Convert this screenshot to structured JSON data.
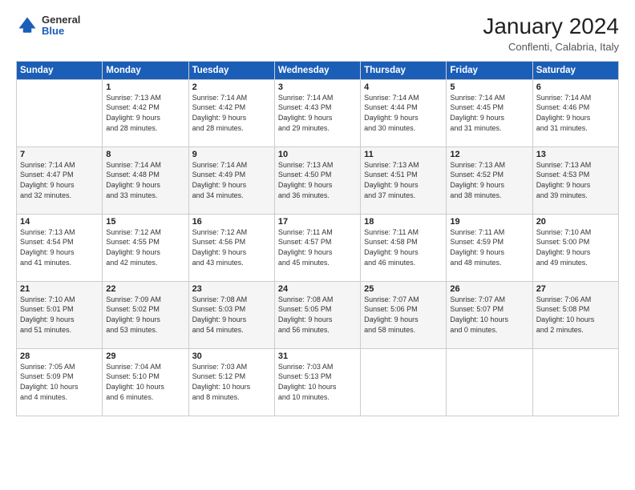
{
  "logo": {
    "general": "General",
    "blue": "Blue"
  },
  "header": {
    "month_year": "January 2024",
    "location": "Conflenti, Calabria, Italy"
  },
  "days_of_week": [
    "Sunday",
    "Monday",
    "Tuesday",
    "Wednesday",
    "Thursday",
    "Friday",
    "Saturday"
  ],
  "weeks": [
    [
      {
        "day": "",
        "info": ""
      },
      {
        "day": "1",
        "info": "Sunrise: 7:13 AM\nSunset: 4:42 PM\nDaylight: 9 hours\nand 28 minutes."
      },
      {
        "day": "2",
        "info": "Sunrise: 7:14 AM\nSunset: 4:42 PM\nDaylight: 9 hours\nand 28 minutes."
      },
      {
        "day": "3",
        "info": "Sunrise: 7:14 AM\nSunset: 4:43 PM\nDaylight: 9 hours\nand 29 minutes."
      },
      {
        "day": "4",
        "info": "Sunrise: 7:14 AM\nSunset: 4:44 PM\nDaylight: 9 hours\nand 30 minutes."
      },
      {
        "day": "5",
        "info": "Sunrise: 7:14 AM\nSunset: 4:45 PM\nDaylight: 9 hours\nand 31 minutes."
      },
      {
        "day": "6",
        "info": "Sunrise: 7:14 AM\nSunset: 4:46 PM\nDaylight: 9 hours\nand 31 minutes."
      }
    ],
    [
      {
        "day": "7",
        "info": "Sunrise: 7:14 AM\nSunset: 4:47 PM\nDaylight: 9 hours\nand 32 minutes."
      },
      {
        "day": "8",
        "info": "Sunrise: 7:14 AM\nSunset: 4:48 PM\nDaylight: 9 hours\nand 33 minutes."
      },
      {
        "day": "9",
        "info": "Sunrise: 7:14 AM\nSunset: 4:49 PM\nDaylight: 9 hours\nand 34 minutes."
      },
      {
        "day": "10",
        "info": "Sunrise: 7:13 AM\nSunset: 4:50 PM\nDaylight: 9 hours\nand 36 minutes."
      },
      {
        "day": "11",
        "info": "Sunrise: 7:13 AM\nSunset: 4:51 PM\nDaylight: 9 hours\nand 37 minutes."
      },
      {
        "day": "12",
        "info": "Sunrise: 7:13 AM\nSunset: 4:52 PM\nDaylight: 9 hours\nand 38 minutes."
      },
      {
        "day": "13",
        "info": "Sunrise: 7:13 AM\nSunset: 4:53 PM\nDaylight: 9 hours\nand 39 minutes."
      }
    ],
    [
      {
        "day": "14",
        "info": "Sunrise: 7:13 AM\nSunset: 4:54 PM\nDaylight: 9 hours\nand 41 minutes."
      },
      {
        "day": "15",
        "info": "Sunrise: 7:12 AM\nSunset: 4:55 PM\nDaylight: 9 hours\nand 42 minutes."
      },
      {
        "day": "16",
        "info": "Sunrise: 7:12 AM\nSunset: 4:56 PM\nDaylight: 9 hours\nand 43 minutes."
      },
      {
        "day": "17",
        "info": "Sunrise: 7:11 AM\nSunset: 4:57 PM\nDaylight: 9 hours\nand 45 minutes."
      },
      {
        "day": "18",
        "info": "Sunrise: 7:11 AM\nSunset: 4:58 PM\nDaylight: 9 hours\nand 46 minutes."
      },
      {
        "day": "19",
        "info": "Sunrise: 7:11 AM\nSunset: 4:59 PM\nDaylight: 9 hours\nand 48 minutes."
      },
      {
        "day": "20",
        "info": "Sunrise: 7:10 AM\nSunset: 5:00 PM\nDaylight: 9 hours\nand 49 minutes."
      }
    ],
    [
      {
        "day": "21",
        "info": "Sunrise: 7:10 AM\nSunset: 5:01 PM\nDaylight: 9 hours\nand 51 minutes."
      },
      {
        "day": "22",
        "info": "Sunrise: 7:09 AM\nSunset: 5:02 PM\nDaylight: 9 hours\nand 53 minutes."
      },
      {
        "day": "23",
        "info": "Sunrise: 7:08 AM\nSunset: 5:03 PM\nDaylight: 9 hours\nand 54 minutes."
      },
      {
        "day": "24",
        "info": "Sunrise: 7:08 AM\nSunset: 5:05 PM\nDaylight: 9 hours\nand 56 minutes."
      },
      {
        "day": "25",
        "info": "Sunrise: 7:07 AM\nSunset: 5:06 PM\nDaylight: 9 hours\nand 58 minutes."
      },
      {
        "day": "26",
        "info": "Sunrise: 7:07 AM\nSunset: 5:07 PM\nDaylight: 10 hours\nand 0 minutes."
      },
      {
        "day": "27",
        "info": "Sunrise: 7:06 AM\nSunset: 5:08 PM\nDaylight: 10 hours\nand 2 minutes."
      }
    ],
    [
      {
        "day": "28",
        "info": "Sunrise: 7:05 AM\nSunset: 5:09 PM\nDaylight: 10 hours\nand 4 minutes."
      },
      {
        "day": "29",
        "info": "Sunrise: 7:04 AM\nSunset: 5:10 PM\nDaylight: 10 hours\nand 6 minutes."
      },
      {
        "day": "30",
        "info": "Sunrise: 7:03 AM\nSunset: 5:12 PM\nDaylight: 10 hours\nand 8 minutes."
      },
      {
        "day": "31",
        "info": "Sunrise: 7:03 AM\nSunset: 5:13 PM\nDaylight: 10 hours\nand 10 minutes."
      },
      {
        "day": "",
        "info": ""
      },
      {
        "day": "",
        "info": ""
      },
      {
        "day": "",
        "info": ""
      }
    ]
  ]
}
